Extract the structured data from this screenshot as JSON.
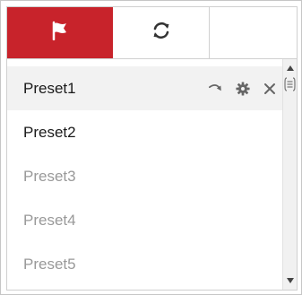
{
  "tabs": [
    {
      "icon": "flag-icon",
      "active": true
    },
    {
      "icon": "refresh-cycle-icon",
      "active": false
    }
  ],
  "presets": [
    {
      "label": "Preset1",
      "defined": true,
      "selected": true
    },
    {
      "label": "Preset2",
      "defined": true,
      "selected": false
    },
    {
      "label": "Preset3",
      "defined": false,
      "selected": false
    },
    {
      "label": "Preset4",
      "defined": false,
      "selected": false
    },
    {
      "label": "Preset5",
      "defined": false,
      "selected": false
    }
  ],
  "row_actions": [
    "call-preset-icon",
    "gear-icon",
    "close-icon"
  ],
  "colors": {
    "accent": "#c8232b",
    "defined_text": "#1a1a1a",
    "undefined_text": "#999999",
    "icon_gray": "#666666"
  }
}
